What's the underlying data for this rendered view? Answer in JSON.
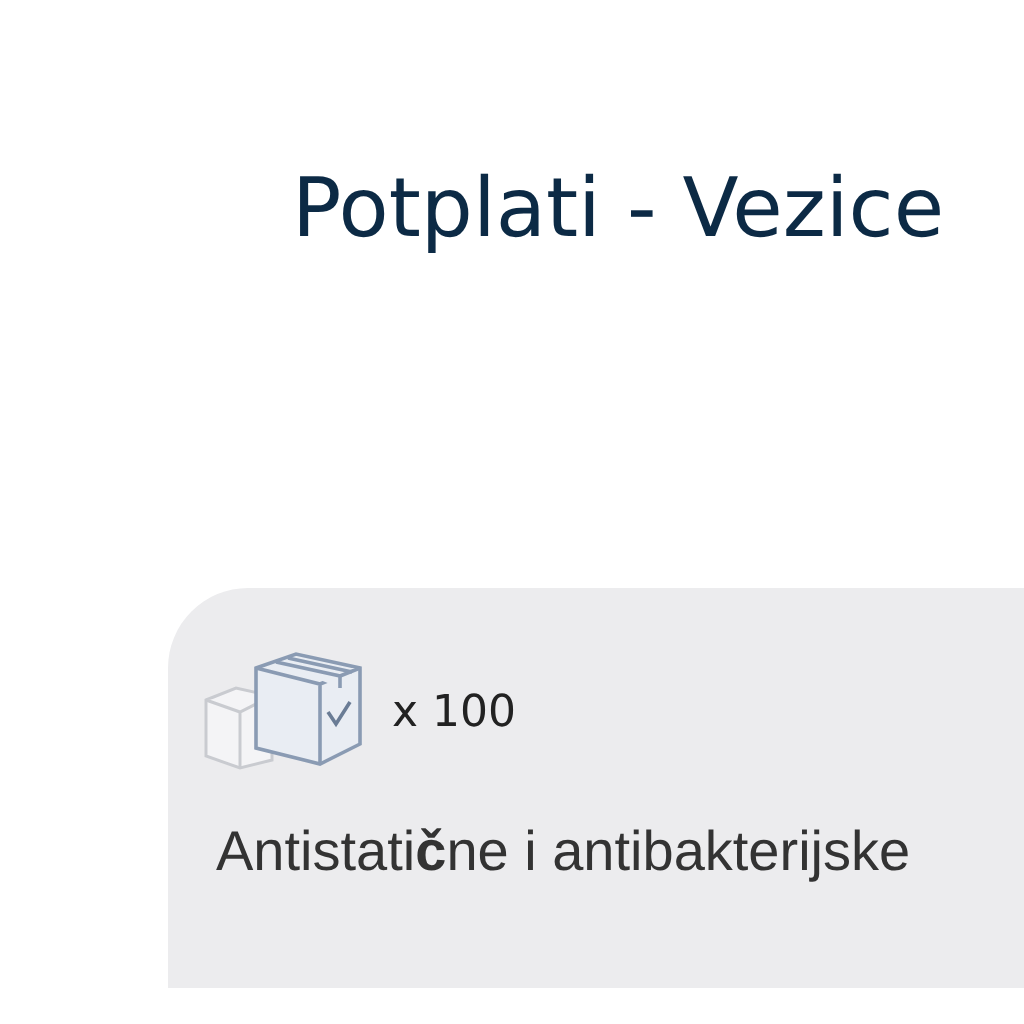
{
  "title": "Potplati - Vezice",
  "card": {
    "quantity": "x 100",
    "description": "Antistati**č**ne i antibakterijske"
  }
}
